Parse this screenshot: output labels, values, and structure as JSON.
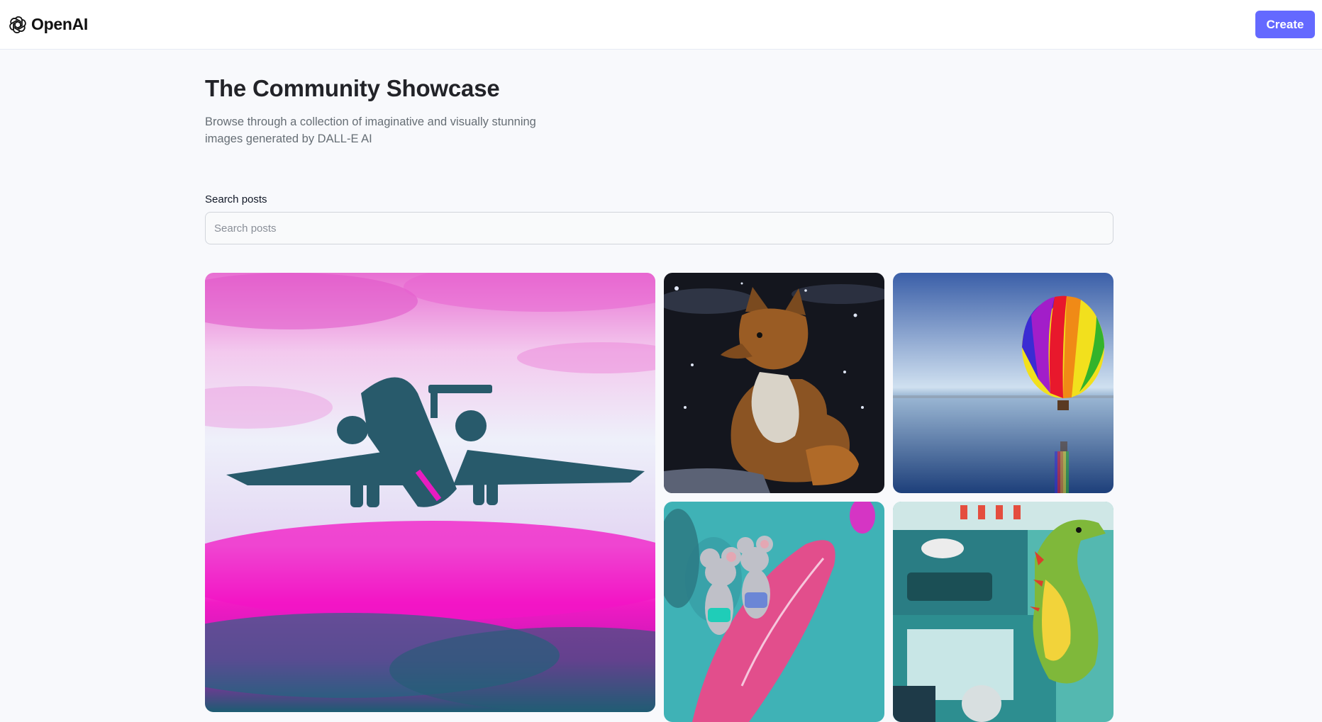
{
  "header": {
    "brand": "OpenAI",
    "create_label": "Create",
    "accent_color": "#6469ff"
  },
  "hero": {
    "title": "The Community Showcase",
    "subtitle": "Browse through a collection of imaginative and visually stunning images generated by DALL-E AI"
  },
  "search": {
    "label": "Search posts",
    "placeholder": "Search posts",
    "value": ""
  },
  "icons": {
    "logo": "openai-logo-icon"
  }
}
